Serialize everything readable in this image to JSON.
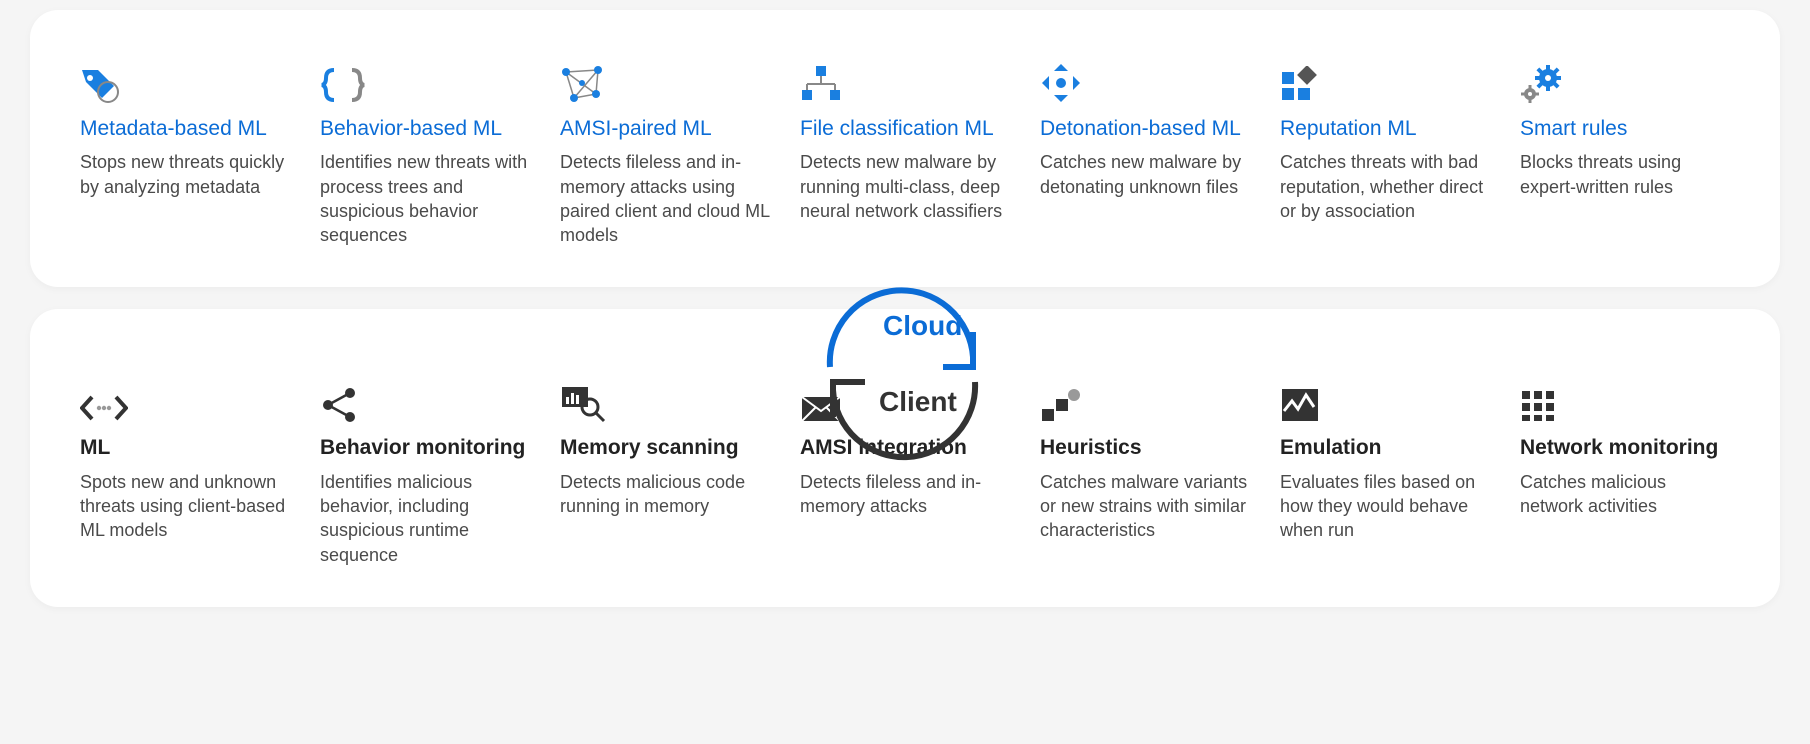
{
  "labels": {
    "cloud": "Cloud",
    "client": "Client"
  },
  "cloud": [
    {
      "id": "metadata-ml",
      "title": "Metadata-based ML",
      "desc": "Stops new threats quickly by analyzing metadata"
    },
    {
      "id": "behavior-ml",
      "title": "Behavior-based ML",
      "desc": "Identifies new threats with process trees and suspicious behavior sequences"
    },
    {
      "id": "amsi-ml",
      "title": "AMSI-paired ML",
      "desc": "Detects fileless and in-memory attacks using paired client and cloud ML models"
    },
    {
      "id": "file-class-ml",
      "title": "File classification ML",
      "desc": "Detects new malware by running multi-class, deep neural network classifiers"
    },
    {
      "id": "detonation-ml",
      "title": "Detonation-based ML",
      "desc": "Catches new malware by detonating unknown files"
    },
    {
      "id": "reputation-ml",
      "title": "Reputation ML",
      "desc": "Catches threats with bad reputation, whether direct or by association"
    },
    {
      "id": "smart-rules",
      "title": "Smart rules",
      "desc": "Blocks threats using expert-written rules"
    }
  ],
  "client": [
    {
      "id": "ml",
      "title": "ML",
      "desc": "Spots new and unknown threats using client-based ML models"
    },
    {
      "id": "behavior-monitor",
      "title": "Behavior monitoring",
      "desc": "Identifies malicious behavior, including suspicious runtime sequence"
    },
    {
      "id": "memory-scan",
      "title": "Memory scanning",
      "desc": "Detects malicious code running in memory"
    },
    {
      "id": "amsi-integration",
      "title": "AMSI integration",
      "desc": "Detects fileless and in-memory attacks"
    },
    {
      "id": "heuristics",
      "title": "Heuristics",
      "desc": "Catches malware variants or new strains with similar characteristics"
    },
    {
      "id": "emulation",
      "title": "Emulation",
      "desc": "Evaluates files based on how they would behave when run"
    },
    {
      "id": "network-monitor",
      "title": "Network monitoring",
      "desc": "Catches malicious network activities"
    }
  ]
}
